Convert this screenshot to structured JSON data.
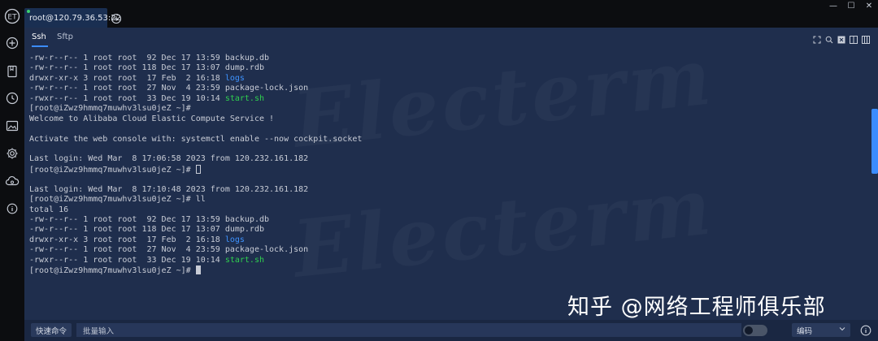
{
  "app": {
    "tab_title": "root@120.79.36.53:22",
    "window_controls": {
      "minimize": "—",
      "maximize": "☐",
      "close": "✕"
    }
  },
  "sidebar": {
    "items": [
      {
        "icon": "electerm-logo-icon"
      },
      {
        "icon": "add-circle-icon"
      },
      {
        "icon": "bookmark-icon"
      },
      {
        "icon": "history-clock-icon"
      },
      {
        "icon": "image-icon"
      },
      {
        "icon": "settings-gear-icon"
      },
      {
        "icon": "cloud-sync-icon"
      },
      {
        "icon": "info-icon"
      }
    ]
  },
  "subtabs": [
    {
      "label": "Ssh",
      "active": true
    },
    {
      "label": "Sftp",
      "active": false
    }
  ],
  "toolbar": {
    "icons": [
      "fullscreen-icon",
      "search-icon",
      "close-box-icon",
      "split-horizontal-icon",
      "split-vertical-icon"
    ]
  },
  "terminal": {
    "lines": [
      {
        "text": "-rw-r--r-- 1 root root  92 Dec 17 13:59 ",
        "hl": "backup.db",
        "cls": ""
      },
      {
        "text": "-rw-r--r-- 1 root root 118 Dec 17 13:07 ",
        "hl": "dump.rdb",
        "cls": ""
      },
      {
        "text": "drwxr-xr-x 3 root root  17 Feb  2 16:18 ",
        "hl": "logs",
        "cls": "c-dir"
      },
      {
        "text": "-rw-r--r-- 1 root root  27 Nov  4 23:59 ",
        "hl": "package-lock.json",
        "cls": ""
      },
      {
        "text": "-rwxr--r-- 1 root root  33 Dec 19 10:14 ",
        "hl": "start.sh",
        "cls": "c-exe"
      },
      {
        "text": "[root@iZwz9hmmq7muwhv3lsu0jeZ ~]# ",
        "hl": "",
        "cls": ""
      },
      {
        "text": "Welcome to Alibaba Cloud Elastic Compute Service !",
        "hl": "",
        "cls": ""
      },
      {
        "text": "",
        "hl": "",
        "cls": ""
      },
      {
        "text": "Activate the web console with: systemctl enable --now cockpit.socket",
        "hl": "",
        "cls": ""
      },
      {
        "text": "",
        "hl": "",
        "cls": ""
      },
      {
        "text": "Last login: Wed Mar  8 17:06:58 2023 from 120.232.161.182",
        "hl": "",
        "cls": ""
      },
      {
        "text": "[root@iZwz9hmmq7muwhv3lsu0jeZ ~]# ",
        "hl": "",
        "cls": "",
        "cursor": "hollow"
      },
      {
        "text": "",
        "hl": "",
        "cls": ""
      },
      {
        "text": "Last login: Wed Mar  8 17:10:48 2023 from 120.232.161.182",
        "hl": "",
        "cls": ""
      },
      {
        "text": "[root@iZwz9hmmq7muwhv3lsu0jeZ ~]# ll",
        "hl": "",
        "cls": ""
      },
      {
        "text": "total 16",
        "hl": "",
        "cls": ""
      },
      {
        "text": "-rw-r--r-- 1 root root  92 Dec 17 13:59 ",
        "hl": "backup.db",
        "cls": ""
      },
      {
        "text": "-rw-r--r-- 1 root root 118 Dec 17 13:07 ",
        "hl": "dump.rdb",
        "cls": ""
      },
      {
        "text": "drwxr-xr-x 3 root root  17 Feb  2 16:18 ",
        "hl": "logs",
        "cls": "c-dir"
      },
      {
        "text": "-rw-r--r-- 1 root root  27 Nov  4 23:59 ",
        "hl": "package-lock.json",
        "cls": ""
      },
      {
        "text": "-rwxr--r-- 1 root root  33 Dec 19 10:14 ",
        "hl": "start.sh",
        "cls": "c-exe"
      },
      {
        "text": "[root@iZwz9hmmq7muwhv3lsu0jeZ ~]# ",
        "hl": "",
        "cls": "",
        "cursor": "solid"
      }
    ]
  },
  "watermark": {
    "text": "Electerm"
  },
  "overlay": {
    "zhihu_text": "知乎 @网络工程师俱乐部"
  },
  "bottombar": {
    "quick_command_label": "快速命令",
    "batch_input_placeholder": "批量输入",
    "encoding_label": "编码"
  },
  "colors": {
    "panel_bg": "#1f2e4d",
    "accent": "#3b8cff",
    "directory": "#3e93ff",
    "executable": "#2fd04f"
  }
}
